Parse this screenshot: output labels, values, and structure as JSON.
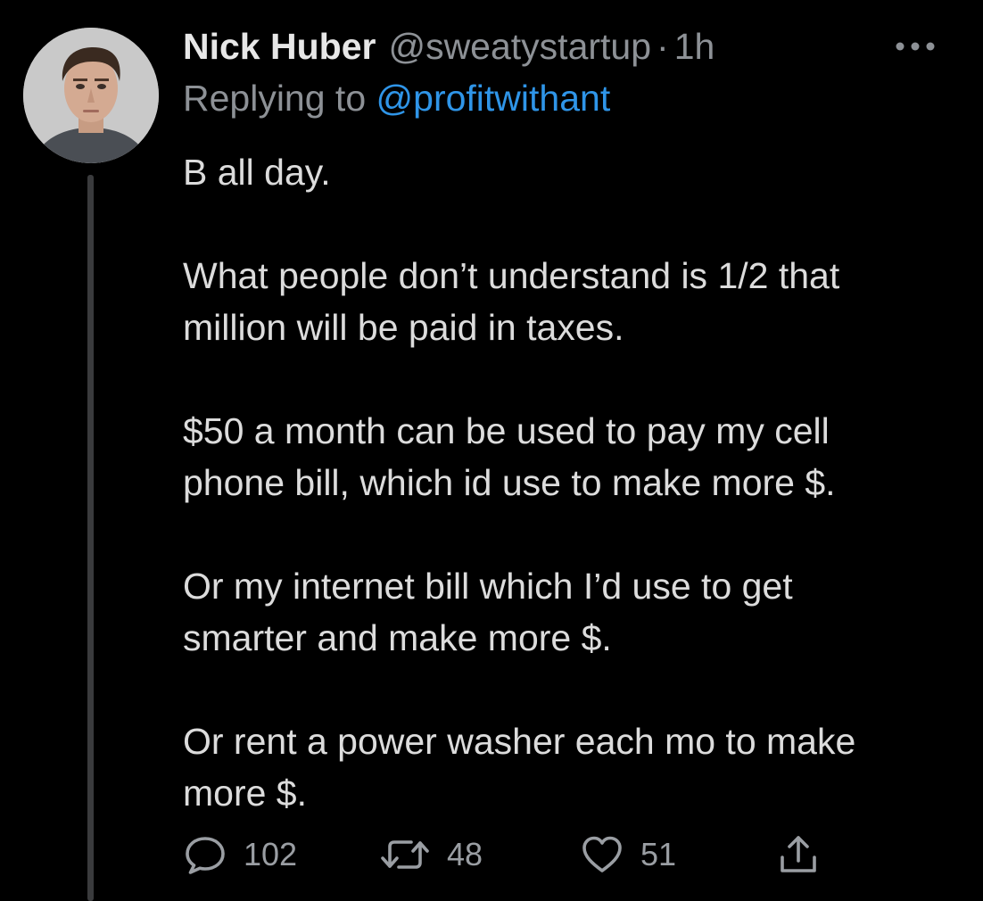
{
  "tweet": {
    "display_name": "Nick Huber",
    "handle": "@sweatystartup",
    "separator": "·",
    "time": "1h",
    "reply_prefix": "Replying to",
    "reply_to_handle": "@profitwithant",
    "paragraphs": [
      [
        "B all day."
      ],
      [
        "What people don’t understand is 1/2 that",
        "million will be paid in taxes."
      ],
      [
        "$50 a month can be used to pay my cell",
        "phone bill, which id use to make more $."
      ],
      [
        "Or my internet bill which I’d use to get",
        "smarter and make more $."
      ],
      [
        "Or rent a power washer each mo to make",
        "more $."
      ]
    ],
    "actions": {
      "reply_icon": "speech-bubble-icon",
      "reply_count": "102",
      "retweet_icon": "retweet-arrows-icon",
      "retweet_count": "48",
      "like_icon": "heart-icon",
      "like_count": "51",
      "share_icon": "share-upload-icon"
    },
    "more_icon": "ellipsis-icon"
  },
  "colors": {
    "background": "#000000",
    "primary_text": "#e7e7e7",
    "secondary_text": "#8d9196",
    "link": "#2f95e8",
    "thread_line": "#3a3b3d"
  }
}
